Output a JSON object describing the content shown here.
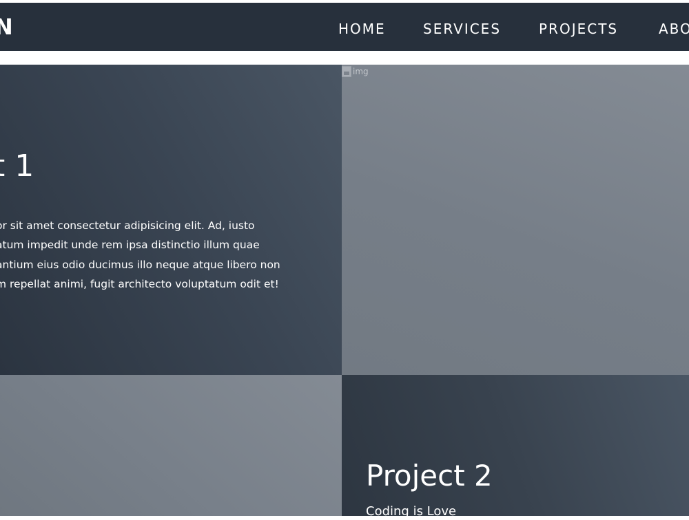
{
  "navbar": {
    "brand": "N",
    "links": {
      "home": "HOME",
      "services": "SERVICES",
      "projects": "PROJECTS",
      "about": "ABO"
    }
  },
  "projects": [
    {
      "title": "t 1",
      "description": "or sit amet consectetur adipisicing elit. Ad, iusto\natum impedit unde rem ipsa distinctio illum quae\nantium eius odio ducimus illo neque atque libero non\nm repellat animi, fugit architecto voluptatum odit et!"
    },
    {
      "title": "Project 2",
      "subtitle": "Coding is Love"
    }
  ],
  "broken_image": {
    "alt": "img",
    "icon": "broken-image-icon"
  },
  "colors": {
    "navbar_bg": "#27303c",
    "text_panel_bg": "#3a4553",
    "image_panel_bg": "#767e88",
    "text": "#ffffff"
  }
}
